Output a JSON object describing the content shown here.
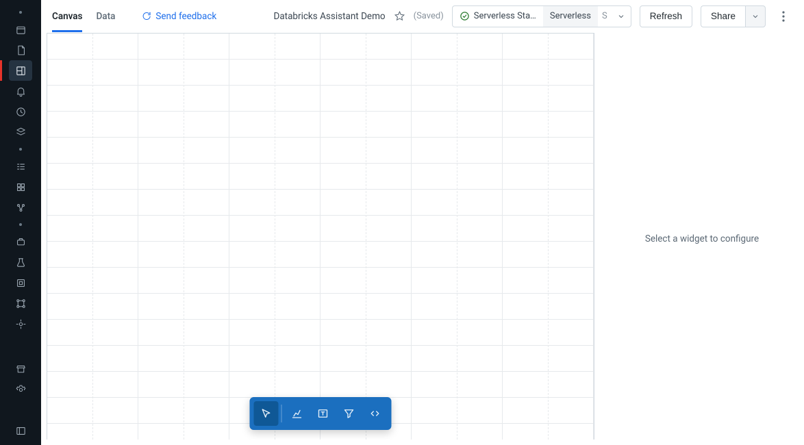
{
  "sidebar": {
    "items": [
      {
        "name": "home-icon"
      },
      {
        "name": "file-icon"
      },
      {
        "name": "dashboard-icon",
        "active": true
      },
      {
        "name": "bell-icon"
      },
      {
        "name": "history-icon"
      },
      {
        "name": "query-icon"
      }
    ],
    "items2": [
      {
        "name": "tasks-icon"
      },
      {
        "name": "data-icon"
      },
      {
        "name": "workflow-icon"
      }
    ],
    "items3": [
      {
        "name": "ml-icon"
      },
      {
        "name": "experiment-icon"
      },
      {
        "name": "compute-icon"
      },
      {
        "name": "graph-icon"
      },
      {
        "name": "settings-icon2"
      }
    ],
    "items4": [
      {
        "name": "marketplace-icon"
      },
      {
        "name": "settings-icon"
      }
    ],
    "bottom": [
      {
        "name": "collapse-icon"
      }
    ]
  },
  "tabs": {
    "canvas": "Canvas",
    "data": "Data"
  },
  "feedback_label": "Send feedback",
  "document": {
    "title": "Databricks Assistant Demo",
    "saved_label": "(Saved)"
  },
  "compute": {
    "status_label": "Serverless Sta…",
    "warehouse_label": "Serverless",
    "avatar_initial": "S"
  },
  "buttons": {
    "refresh": "Refresh",
    "share": "Share"
  },
  "config_panel": {
    "placeholder": "Select a widget to configure"
  },
  "widget_toolbar": {
    "tools": [
      {
        "name": "select-tool",
        "active": true
      },
      {
        "name": "chart-tool"
      },
      {
        "name": "text-tool"
      },
      {
        "name": "filter-tool"
      },
      {
        "name": "code-tool"
      }
    ]
  }
}
